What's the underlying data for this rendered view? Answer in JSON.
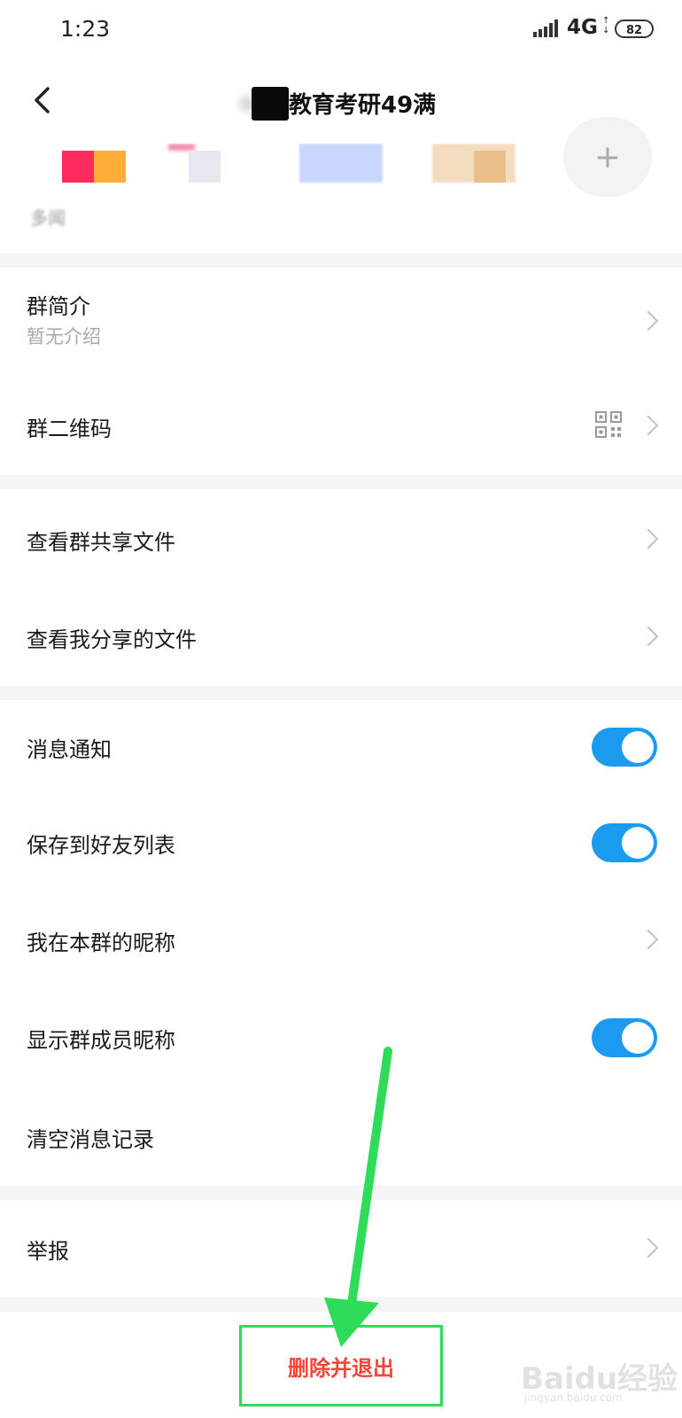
{
  "status_bar": {
    "time": "1:23",
    "network": "4G",
    "battery": "82"
  },
  "header": {
    "title": "教育考研49满"
  },
  "members": {
    "label": "多闻"
  },
  "sections": {
    "group_intro": {
      "label": "群简介",
      "sub": "暂无介绍"
    },
    "group_qr": {
      "label": "群二维码"
    },
    "shared_files": {
      "label": "查看群共享文件"
    },
    "my_files": {
      "label": "查看我分享的文件"
    },
    "notify": {
      "label": "消息通知",
      "on": true
    },
    "save_contacts": {
      "label": "保存到好友列表",
      "on": true
    },
    "my_nickname": {
      "label": "我在本群的昵称"
    },
    "show_nicknames": {
      "label": "显示群成员昵称",
      "on": true
    },
    "clear_history": {
      "label": "清空消息记录"
    },
    "report": {
      "label": "举报"
    }
  },
  "footer": {
    "delete_exit_label": "删除并退出"
  },
  "watermark": {
    "text": "Baidu经验",
    "sub": "jingyan.baidu.com"
  },
  "colors": {
    "accent": "#1b9bf0",
    "danger": "#f0473a",
    "highlight": "#2fdc5a",
    "divider": "#f5f5f5"
  }
}
